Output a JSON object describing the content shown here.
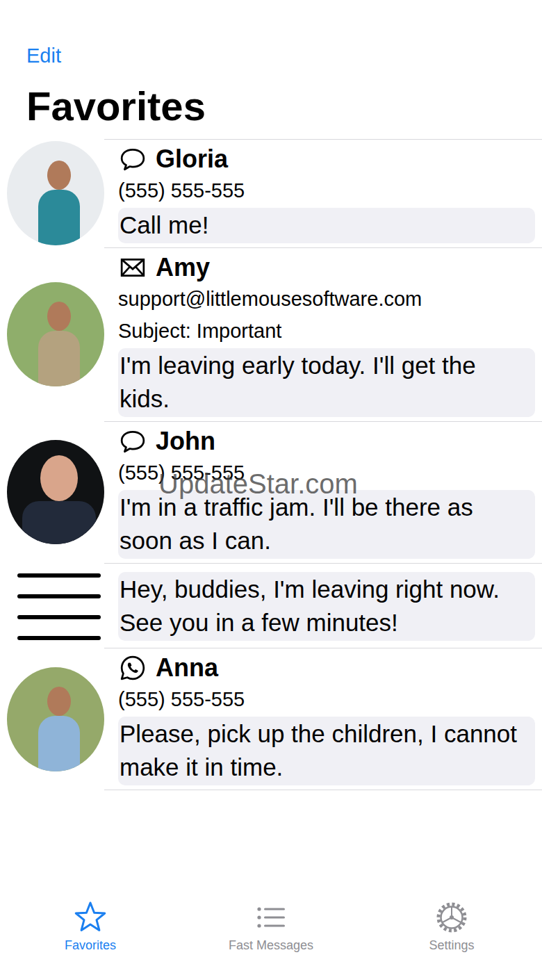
{
  "nav": {
    "edit": "Edit",
    "title": "Favorites"
  },
  "favorites": [
    {
      "kind": "sms",
      "name": "Gloria",
      "lines": [
        "(555) 555-555"
      ],
      "message": "Call me!"
    },
    {
      "kind": "email",
      "name": "Amy",
      "lines": [
        "support@littlemousesoftware.com",
        "Subject: Important"
      ],
      "message": "I'm leaving early today. I'll get the kids."
    },
    {
      "kind": "sms",
      "name": "John",
      "lines": [
        "(555) 555-555"
      ],
      "message": "I'm in a traffic jam. I'll be there as soon as I can."
    },
    {
      "kind": "group",
      "name": "",
      "lines": [],
      "message": "Hey, buddies, I'm leaving right now. See you in a few minutes!"
    },
    {
      "kind": "whatsapp",
      "name": "Anna",
      "lines": [
        "(555) 555-555"
      ],
      "message": "Please, pick up the children, I cannot make it in time."
    }
  ],
  "watermark": "UpdateStar.com",
  "tabs": [
    {
      "label": "Favorites",
      "selected": true
    },
    {
      "label": "Fast Messages",
      "selected": false
    },
    {
      "label": "Settings",
      "selected": false
    }
  ]
}
